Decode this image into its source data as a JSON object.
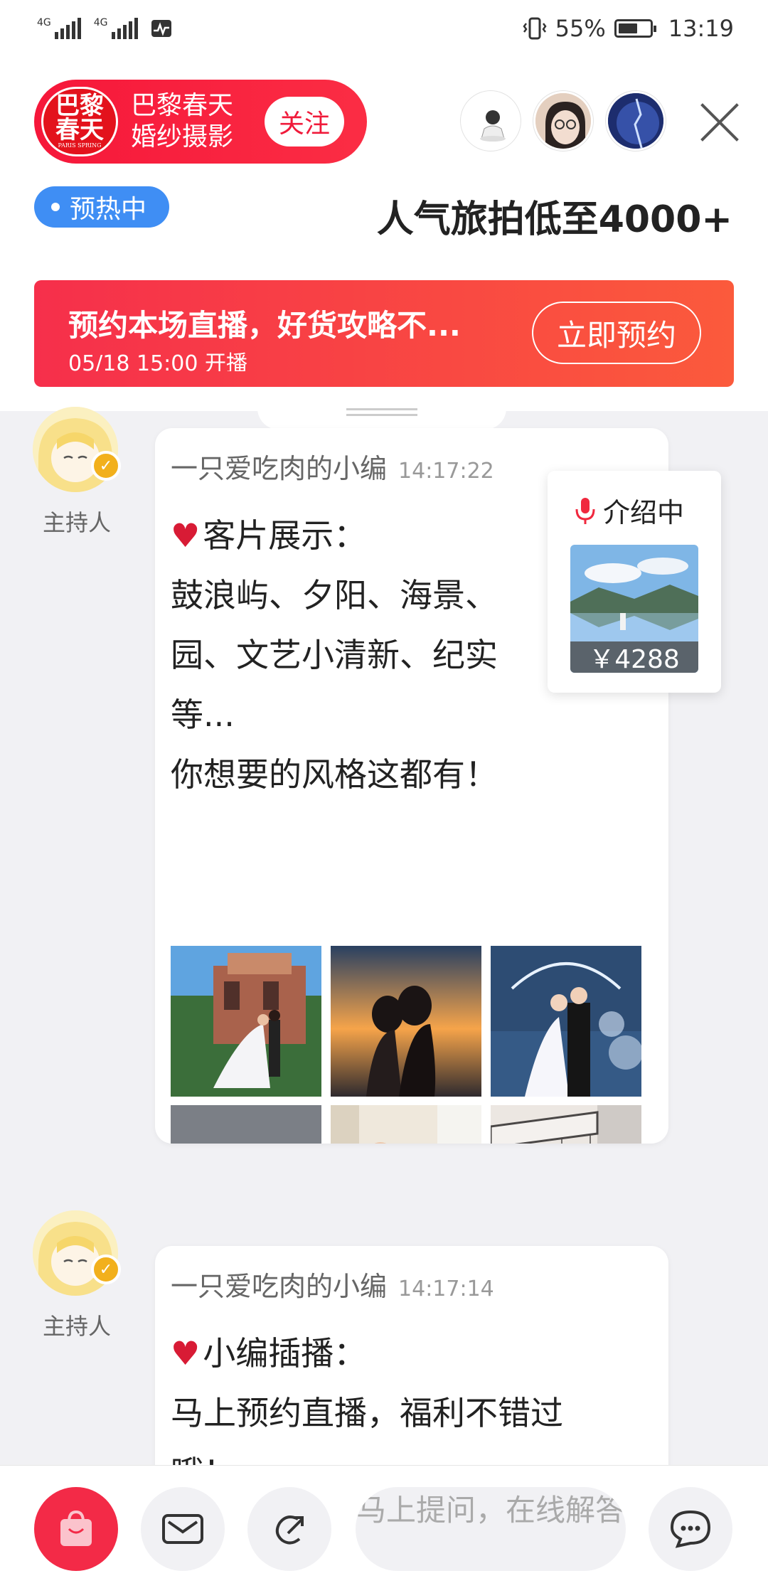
{
  "status_bar": {
    "network_1": "4G",
    "network_2": "4G",
    "battery": "55%",
    "time": "13:19"
  },
  "store": {
    "logo_line1": "巴黎",
    "logo_line2": "春天",
    "logo_sub": "PARIS SPRING",
    "name": "巴黎春天婚纱摄影",
    "follow_label": "关注"
  },
  "live": {
    "status_badge": "预热中",
    "promo_title": "人气旅拍低至4000+"
  },
  "reserve": {
    "main_text": "预约本场直播，好货攻略不...",
    "sub_text": "05/18 15:00 开播",
    "button_label": "立即预约"
  },
  "messages": [
    {
      "host_label": "主持人",
      "author": "一只爱吃肉的小编",
      "time": "14:17:22",
      "lines": [
        "客片展示：",
        "鼓浪屿、夕阳、海景、",
        "园、文艺小清新、纪实",
        "等...",
        "你想要的风格这都有！"
      ]
    },
    {
      "host_label": "主持人",
      "author": "一只爱吃肉的小编",
      "time": "14:17:14",
      "lines": [
        "小编插播：",
        "马上预约直播，福利不错过",
        "哦！"
      ]
    }
  ],
  "intro_card": {
    "label": "介绍中",
    "price": "￥4288"
  },
  "toolbar": {
    "ask_placeholder": "马上提问，在线解答"
  },
  "colors": {
    "brand_red": "#f6173a",
    "preheat_blue": "#3f8ef4",
    "verified_gold": "#f2b01c"
  }
}
